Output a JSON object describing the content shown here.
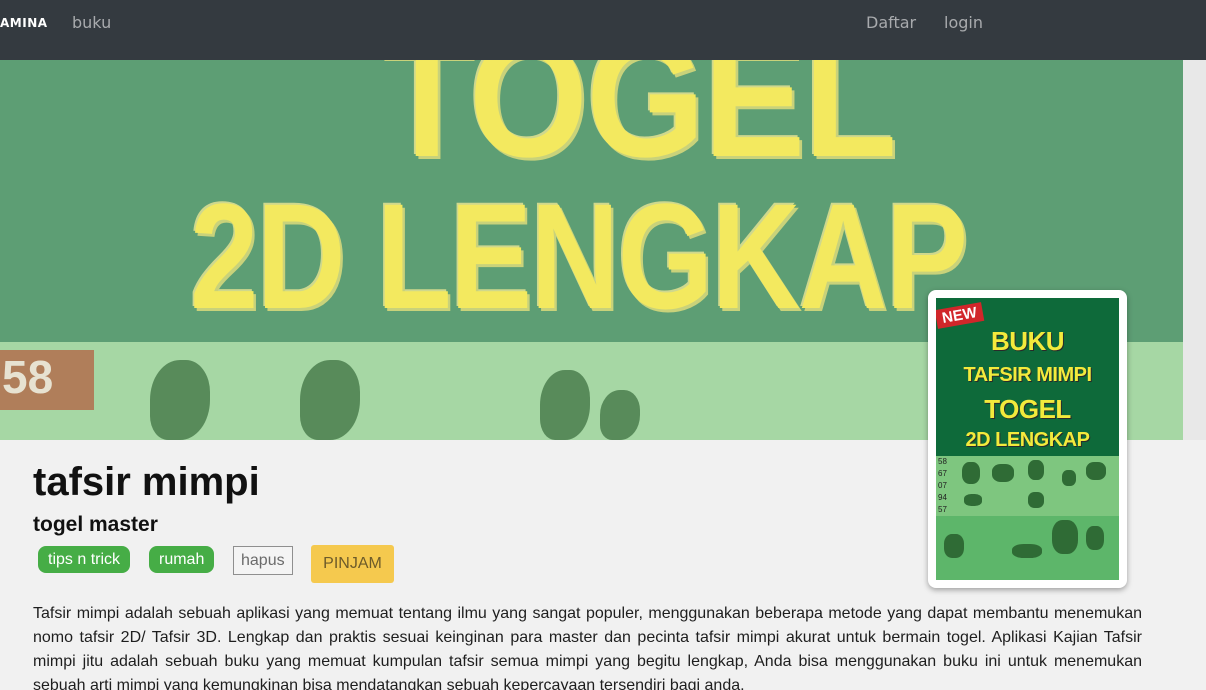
{
  "nav": {
    "brand": "AMINA",
    "links": [
      {
        "label": "buku"
      },
      {
        "label": "Daftar"
      },
      {
        "label": "login"
      }
    ]
  },
  "hero": {
    "line1": "TOGEL",
    "line2": "2D LENGKAP",
    "number": "58"
  },
  "cover": {
    "badge": "NEW",
    "line1": "BUKU",
    "line2": "TAFSIR MIMPI",
    "line3": "TOGEL",
    "line4": "2D LENGKAP",
    "numbers": [
      "58",
      "67",
      "07",
      "94",
      "57"
    ]
  },
  "book": {
    "title": "tafsir mimpi",
    "author": "togel master",
    "tags": [
      "tips n trick",
      "rumah"
    ],
    "delete_label": "hapus",
    "borrow_label": "PINJAM",
    "description": "Tafsir mimpi adalah sebuah aplikasi yang memuat tentang ilmu yang sangat populer, menggunakan beberapa metode yang dapat membantu menemukan nomo tafsir 2D/ Tafsir 3D. Lengkap dan praktis sesuai keinginan para master dan pecinta tafsir mimpi akurat untuk bermain togel. Aplikasi Kajian Tafsir mimpi jitu adalah sebuah buku yang memuat kumpulan tafsir semua mimpi yang begitu lengkap, Anda bisa menggunakan buku ini untuk menemukan sebuah arti mimpi yang kemungkinan bisa mendatangkan sebuah kepercayaan tersendiri bagi anda."
  },
  "colors": {
    "navbar": "#343a40",
    "tag": "#46ad46",
    "borrow": "#f5c94e"
  }
}
